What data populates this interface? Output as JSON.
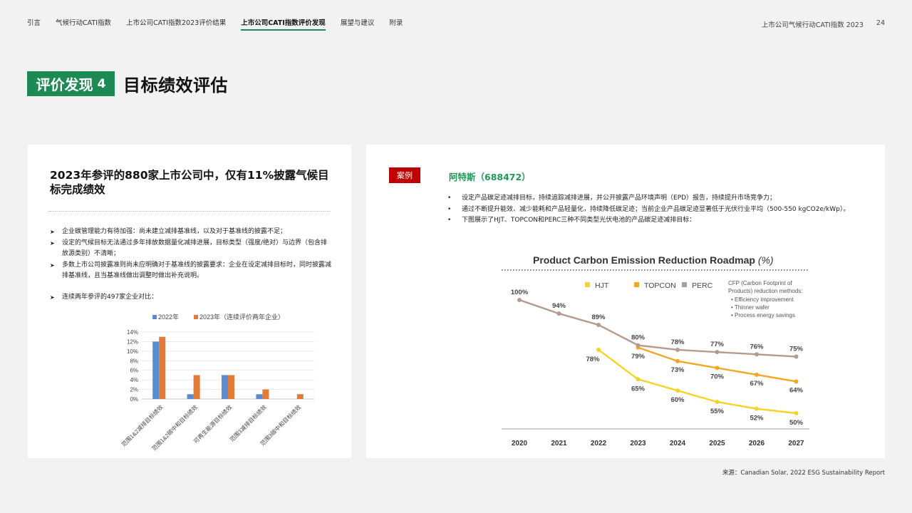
{
  "nav": {
    "items": [
      "引言",
      "气候行动CATI指数",
      "上市公司CATI指数2023评价结果",
      "上市公司CATI指数评价发现",
      "展望与建议",
      "附录"
    ],
    "active_index": 3
  },
  "header": {
    "report_title": "上市公司气候行动CATI指数 2023",
    "page_number": "24"
  },
  "title": {
    "badge_text": "评价发现",
    "badge_num": "4",
    "heading": "目标绩效评估"
  },
  "left": {
    "heading": "2023年参评的880家上市公司中，仅有11%披露气候目标完成绩效",
    "bullets": [
      "企业碳管理能力有待加强：尚未建立减排基准线，以及对于基准线的披露不足；",
      "设定的气候目标无法通过多年排放数据量化减排进展，目标类型（强度/绝对）与边界（包含排放源类别）不清晰；",
      "多数上市公司披露准则尚未应明确对于基准线的披露要求：企业在设定减排目标时，同时披露减排基准线，且当基准线做出调整时做出补充说明。",
      "连续两年参评的497家企业对比："
    ]
  },
  "chart_data": [
    {
      "type": "bar",
      "categories": [
        "范围1&2减排目标绩效",
        "范围1&2碳中和目标绩效",
        "可再生能源目标绩效",
        "范围3减排目标绩效",
        "范围3碳中和目标绩效"
      ],
      "series": [
        {
          "name": "2022年",
          "values": [
            12,
            1,
            5,
            1,
            0
          ],
          "color": "#5b8bd0"
        },
        {
          "name": "2023年（连续评价两年企业）",
          "values": [
            13,
            5,
            5,
            2,
            1
          ],
          "color": "#e07b39"
        }
      ],
      "yticks": [
        "14%",
        "12%",
        "10%",
        "8%",
        "6%",
        "4%",
        "2%",
        "0%"
      ],
      "ylim": [
        0,
        14
      ],
      "legend": "top"
    },
    {
      "type": "line",
      "title": "Product Carbon Emission Reduction Roadmap",
      "title_suffix": "(%)",
      "x": [
        "2020",
        "2021",
        "2022",
        "2023",
        "2024",
        "2025",
        "2026",
        "2027"
      ],
      "series": [
        {
          "name": "HJT",
          "color": "#f5d327",
          "values": [
            null,
            null,
            78,
            65,
            60,
            55,
            52,
            50
          ]
        },
        {
          "name": "TOPCON",
          "color": "#f5a623",
          "values": [
            null,
            null,
            null,
            79,
            73,
            70,
            67,
            64
          ]
        },
        {
          "name": "PERC",
          "color": "#b59a8d",
          "values": [
            100,
            94,
            89,
            80,
            78,
            77,
            76,
            75
          ]
        }
      ],
      "labels": {
        "PERC": [
          "100%",
          "94%",
          "89%",
          "80%",
          "78%",
          "77%",
          "76%",
          "75%"
        ],
        "HJT": [
          "78%",
          "65%",
          "60%",
          "55%",
          "52%",
          "50%"
        ],
        "TOPCON": [
          "79%",
          "73%",
          "70%",
          "67%",
          "64%"
        ]
      },
      "note_title": "CFP (Carbon Footprint of Products) reduction methods:",
      "note_items": [
        "Efficiency improvement",
        "Thinner wafer",
        "Process energy savings"
      ],
      "legend": "top"
    }
  ],
  "case": {
    "tag": "案例",
    "company": "阿特斯（688472）",
    "bullets": [
      "设定产品碳足迹减排目标，持续追踪减排进展，并公开披露产品环境声明（EPD）报告，持续提升市场竞争力；",
      "通过不断提升能效、减少能耗和产品轻量化，持续降低碳足迹；当前企业产品碳足迹显著低于光伏行业平均（500-550 kgCO2e/kWp）。",
      "下图展示了HJT、TOPCON和PERC三种不同类型光伏电池的产品碳足迹减排目标："
    ]
  },
  "source": "来源：Canadian Solar, 2022 ESG Sustainability Report"
}
